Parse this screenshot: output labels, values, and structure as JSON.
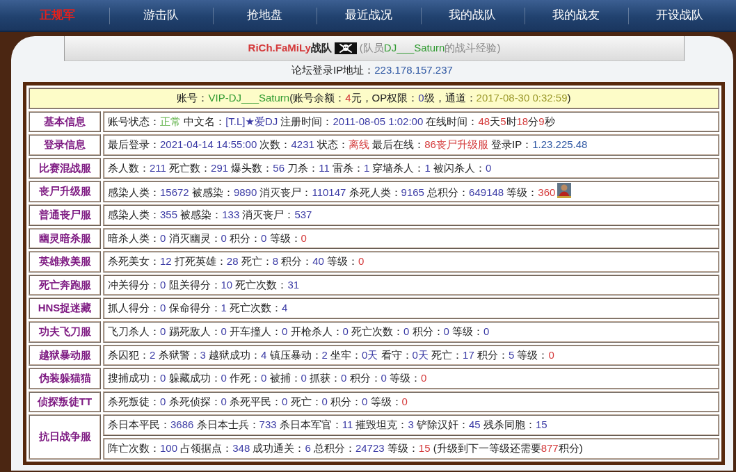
{
  "navigation": [
    {
      "label": "正规军",
      "selected": true
    },
    {
      "label": "游击队",
      "selected": false
    },
    {
      "label": "抢地盘",
      "selected": false
    },
    {
      "label": "最近战况",
      "selected": false
    },
    {
      "label": "我的战队",
      "selected": false
    },
    {
      "label": "我的战友",
      "selected": false
    },
    {
      "label": "开设战队",
      "selected": false
    }
  ],
  "title_bar": {
    "team": [
      {
        "text": "RiCh.FaMiLy",
        "kind": "alert"
      },
      {
        "text": "战队",
        "kind": "text"
      }
    ],
    "subtitle": [
      {
        "text": "(队员",
        "kind": "muted"
      },
      {
        "text": "DJ___Saturn",
        "kind": "name"
      },
      {
        "text": "的战斗经验)",
        "kind": "muted"
      }
    ]
  },
  "login_ip": [
    {
      "text": "论坛登录IP地址：",
      "kind": "text"
    },
    {
      "text": "223.178.157.237",
      "kind": "link"
    }
  ],
  "account": [
    {
      "text": "账号：",
      "kind": "text"
    },
    {
      "text": "VIP-DJ___Saturn",
      "kind": "name"
    },
    {
      "text": "(账号余额：",
      "kind": "text"
    },
    {
      "text": "4",
      "kind": "alert"
    },
    {
      "text": "元，OP权限：",
      "kind": "text"
    },
    {
      "text": "0",
      "kind": "value"
    },
    {
      "text": "级，通道：",
      "kind": "text"
    },
    {
      "text": "2017-08-30 0:32:59",
      "kind": "date"
    },
    {
      "text": ")",
      "kind": "text"
    }
  ],
  "rows": [
    {
      "label": "基本信息",
      "lines": [
        [
          {
            "text": "账号状态：",
            "kind": "text"
          },
          {
            "text": "正常",
            "kind": "ok"
          },
          {
            "text": " 中文名：",
            "kind": "text"
          },
          {
            "text": "[T.L]★爱DJ",
            "kind": "value"
          },
          {
            "text": " 注册时间：",
            "kind": "text"
          },
          {
            "text": "2011-08-05 1:02:00",
            "kind": "value"
          },
          {
            "text": " 在线时间：",
            "kind": "text"
          },
          {
            "text": "48",
            "kind": "alert"
          },
          {
            "text": "天",
            "kind": "text"
          },
          {
            "text": "5",
            "kind": "alert"
          },
          {
            "text": "时",
            "kind": "text"
          },
          {
            "text": "18",
            "kind": "alert"
          },
          {
            "text": "分",
            "kind": "text"
          },
          {
            "text": "9",
            "kind": "alert"
          },
          {
            "text": "秒",
            "kind": "text"
          }
        ]
      ]
    },
    {
      "label": "登录信息",
      "lines": [
        [
          {
            "text": "最后登录：",
            "kind": "text"
          },
          {
            "text": "2021-04-14 14:55:00",
            "kind": "value"
          },
          {
            "text": " 次数：",
            "kind": "text"
          },
          {
            "text": "4231",
            "kind": "value"
          },
          {
            "text": " 状态：",
            "kind": "text"
          },
          {
            "text": "离线",
            "kind": "alert"
          },
          {
            "text": " 最后在线：",
            "kind": "text"
          },
          {
            "text": "86丧尸升级服",
            "kind": "alert"
          },
          {
            "text": " 登录IP：",
            "kind": "text"
          },
          {
            "text": "1.23.225.48",
            "kind": "link"
          }
        ]
      ]
    },
    {
      "label": "比赛混战服",
      "lines": [
        [
          {
            "text": "杀人数：",
            "kind": "text"
          },
          {
            "text": "211",
            "kind": "value"
          },
          {
            "text": " 死亡数：",
            "kind": "text"
          },
          {
            "text": "291",
            "kind": "value"
          },
          {
            "text": " 爆头数：",
            "kind": "text"
          },
          {
            "text": "56",
            "kind": "value"
          },
          {
            "text": " 刀杀：",
            "kind": "text"
          },
          {
            "text": "11",
            "kind": "value"
          },
          {
            "text": " 雷杀：",
            "kind": "text"
          },
          {
            "text": "1",
            "kind": "value"
          },
          {
            "text": " 穿墙杀人：",
            "kind": "text"
          },
          {
            "text": "1",
            "kind": "value"
          },
          {
            "text": " 被闪杀人：",
            "kind": "text"
          },
          {
            "text": "0",
            "kind": "value"
          }
        ]
      ]
    },
    {
      "label": "丧尸升级服",
      "lines": [
        [
          {
            "text": "感染人类：",
            "kind": "text"
          },
          {
            "text": "15672",
            "kind": "value"
          },
          {
            "text": " 被感染：",
            "kind": "text"
          },
          {
            "text": "9890",
            "kind": "value"
          },
          {
            "text": " 消灭丧尸：",
            "kind": "text"
          },
          {
            "text": "110147",
            "kind": "value"
          },
          {
            "text": " 杀死人类：",
            "kind": "text"
          },
          {
            "text": "9165",
            "kind": "value"
          },
          {
            "text": " 总积分：",
            "kind": "text"
          },
          {
            "text": "649148",
            "kind": "value"
          },
          {
            "text": " 等级：",
            "kind": "text"
          },
          {
            "text": "360",
            "kind": "alert"
          },
          {
            "kind": "icon"
          }
        ]
      ]
    },
    {
      "label": "普通丧尸服",
      "lines": [
        [
          {
            "text": "感染人类：",
            "kind": "text"
          },
          {
            "text": "355",
            "kind": "value"
          },
          {
            "text": " 被感染：",
            "kind": "text"
          },
          {
            "text": "133",
            "kind": "value"
          },
          {
            "text": " 消灭丧尸：",
            "kind": "text"
          },
          {
            "text": "537",
            "kind": "value"
          }
        ]
      ]
    },
    {
      "label": "幽灵暗杀服",
      "lines": [
        [
          {
            "text": "暗杀人类：",
            "kind": "text"
          },
          {
            "text": "0",
            "kind": "value"
          },
          {
            "text": " 消灭幽灵：",
            "kind": "text"
          },
          {
            "text": "0",
            "kind": "value"
          },
          {
            "text": " 积分：",
            "kind": "text"
          },
          {
            "text": "0",
            "kind": "value"
          },
          {
            "text": " 等级：",
            "kind": "text"
          },
          {
            "text": "0",
            "kind": "alert"
          }
        ]
      ]
    },
    {
      "label": "英雄救美服",
      "lines": [
        [
          {
            "text": "杀死美女：",
            "kind": "text"
          },
          {
            "text": "12",
            "kind": "value"
          },
          {
            "text": " 打死英雄：",
            "kind": "text"
          },
          {
            "text": "28",
            "kind": "value"
          },
          {
            "text": " 死亡：",
            "kind": "text"
          },
          {
            "text": "8",
            "kind": "value"
          },
          {
            "text": " 积分：",
            "kind": "text"
          },
          {
            "text": "40",
            "kind": "value"
          },
          {
            "text": " 等级：",
            "kind": "text"
          },
          {
            "text": "0",
            "kind": "alert"
          }
        ]
      ]
    },
    {
      "label": "死亡奔跑服",
      "lines": [
        [
          {
            "text": "冲关得分：",
            "kind": "text"
          },
          {
            "text": "0",
            "kind": "value"
          },
          {
            "text": " 阻关得分：",
            "kind": "text"
          },
          {
            "text": "10",
            "kind": "value"
          },
          {
            "text": " 死亡次数：",
            "kind": "text"
          },
          {
            "text": "31",
            "kind": "value"
          }
        ]
      ]
    },
    {
      "label": "HNS捉迷藏",
      "lines": [
        [
          {
            "text": "抓人得分：",
            "kind": "text"
          },
          {
            "text": "0",
            "kind": "value"
          },
          {
            "text": " 保命得分：",
            "kind": "text"
          },
          {
            "text": "1",
            "kind": "value"
          },
          {
            "text": " 死亡次数：",
            "kind": "text"
          },
          {
            "text": "4",
            "kind": "value"
          }
        ]
      ]
    },
    {
      "label": "功夫飞刀服",
      "lines": [
        [
          {
            "text": "飞刀杀人：",
            "kind": "text"
          },
          {
            "text": "0",
            "kind": "value"
          },
          {
            "text": " 踢死敌人：",
            "kind": "text"
          },
          {
            "text": "0",
            "kind": "value"
          },
          {
            "text": " 开车撞人：",
            "kind": "text"
          },
          {
            "text": "0",
            "kind": "value"
          },
          {
            "text": " 开枪杀人：",
            "kind": "text"
          },
          {
            "text": "0",
            "kind": "value"
          },
          {
            "text": " 死亡次数：",
            "kind": "text"
          },
          {
            "text": "0",
            "kind": "value"
          },
          {
            "text": " 积分：",
            "kind": "text"
          },
          {
            "text": "0",
            "kind": "value"
          },
          {
            "text": " 等级：",
            "kind": "text"
          },
          {
            "text": "0",
            "kind": "value"
          }
        ]
      ]
    },
    {
      "label": "越狱暴动服",
      "lines": [
        [
          {
            "text": "杀囚犯：",
            "kind": "text"
          },
          {
            "text": "2",
            "kind": "value"
          },
          {
            "text": " 杀狱警：",
            "kind": "text"
          },
          {
            "text": "3",
            "kind": "value"
          },
          {
            "text": " 越狱成功：",
            "kind": "text"
          },
          {
            "text": "4",
            "kind": "value"
          },
          {
            "text": " 镇压暴动：",
            "kind": "text"
          },
          {
            "text": "2",
            "kind": "value"
          },
          {
            "text": " 坐牢：",
            "kind": "text"
          },
          {
            "text": "0天",
            "kind": "value"
          },
          {
            "text": " 看守：",
            "kind": "text"
          },
          {
            "text": "0天",
            "kind": "value"
          },
          {
            "text": " 死亡：",
            "kind": "text"
          },
          {
            "text": "17",
            "kind": "value"
          },
          {
            "text": " 积分：",
            "kind": "text"
          },
          {
            "text": "5",
            "kind": "value"
          },
          {
            "text": " 等级：",
            "kind": "text"
          },
          {
            "text": "0",
            "kind": "alert"
          }
        ]
      ]
    },
    {
      "label": "伪装躲猫猫",
      "lines": [
        [
          {
            "text": "搜捕成功：",
            "kind": "text"
          },
          {
            "text": "0",
            "kind": "value"
          },
          {
            "text": " 躲藏成功：",
            "kind": "text"
          },
          {
            "text": "0",
            "kind": "value"
          },
          {
            "text": " 作死：",
            "kind": "text"
          },
          {
            "text": "0",
            "kind": "value"
          },
          {
            "text": " 被捕：",
            "kind": "text"
          },
          {
            "text": "0",
            "kind": "value"
          },
          {
            "text": " 抓获：",
            "kind": "text"
          },
          {
            "text": "0",
            "kind": "value"
          },
          {
            "text": " 积分：",
            "kind": "text"
          },
          {
            "text": "0",
            "kind": "value"
          },
          {
            "text": " 等级：",
            "kind": "text"
          },
          {
            "text": "0",
            "kind": "alert"
          }
        ]
      ]
    },
    {
      "label": "侦探叛徒TT",
      "lines": [
        [
          {
            "text": "杀死叛徒：",
            "kind": "text"
          },
          {
            "text": "0",
            "kind": "value"
          },
          {
            "text": " 杀死侦探：",
            "kind": "text"
          },
          {
            "text": "0",
            "kind": "value"
          },
          {
            "text": " 杀死平民：",
            "kind": "text"
          },
          {
            "text": "0",
            "kind": "value"
          },
          {
            "text": " 死亡：",
            "kind": "text"
          },
          {
            "text": "0",
            "kind": "value"
          },
          {
            "text": " 积分：",
            "kind": "text"
          },
          {
            "text": "0",
            "kind": "value"
          },
          {
            "text": " 等级：",
            "kind": "text"
          },
          {
            "text": "0",
            "kind": "alert"
          }
        ]
      ]
    },
    {
      "label": "抗日战争服",
      "lines": [
        [
          {
            "text": "杀日本平民：",
            "kind": "text"
          },
          {
            "text": "3686",
            "kind": "value"
          },
          {
            "text": " 杀日本士兵：",
            "kind": "text"
          },
          {
            "text": "733",
            "kind": "value"
          },
          {
            "text": " 杀日本军官：",
            "kind": "text"
          },
          {
            "text": "11",
            "kind": "value"
          },
          {
            "text": " 摧毁坦克：",
            "kind": "text"
          },
          {
            "text": "3",
            "kind": "value"
          },
          {
            "text": " 铲除汉奸：",
            "kind": "text"
          },
          {
            "text": "45",
            "kind": "value"
          },
          {
            "text": " 残杀同胞：",
            "kind": "text"
          },
          {
            "text": "15",
            "kind": "value"
          }
        ],
        [
          {
            "text": "阵亡次数：",
            "kind": "text"
          },
          {
            "text": "100",
            "kind": "value"
          },
          {
            "text": " 占领据点：",
            "kind": "text"
          },
          {
            "text": "348",
            "kind": "value"
          },
          {
            "text": " 成功通关：",
            "kind": "text"
          },
          {
            "text": "6",
            "kind": "value"
          },
          {
            "text": " 总积分：",
            "kind": "text"
          },
          {
            "text": "24723",
            "kind": "value"
          },
          {
            "text": " 等级：",
            "kind": "text"
          },
          {
            "text": "15",
            "kind": "alert"
          },
          {
            "text": " (升级到下一等级还需要",
            "kind": "text"
          },
          {
            "text": "877",
            "kind": "alert"
          },
          {
            "text": "积分)",
            "kind": "text"
          }
        ]
      ]
    }
  ]
}
